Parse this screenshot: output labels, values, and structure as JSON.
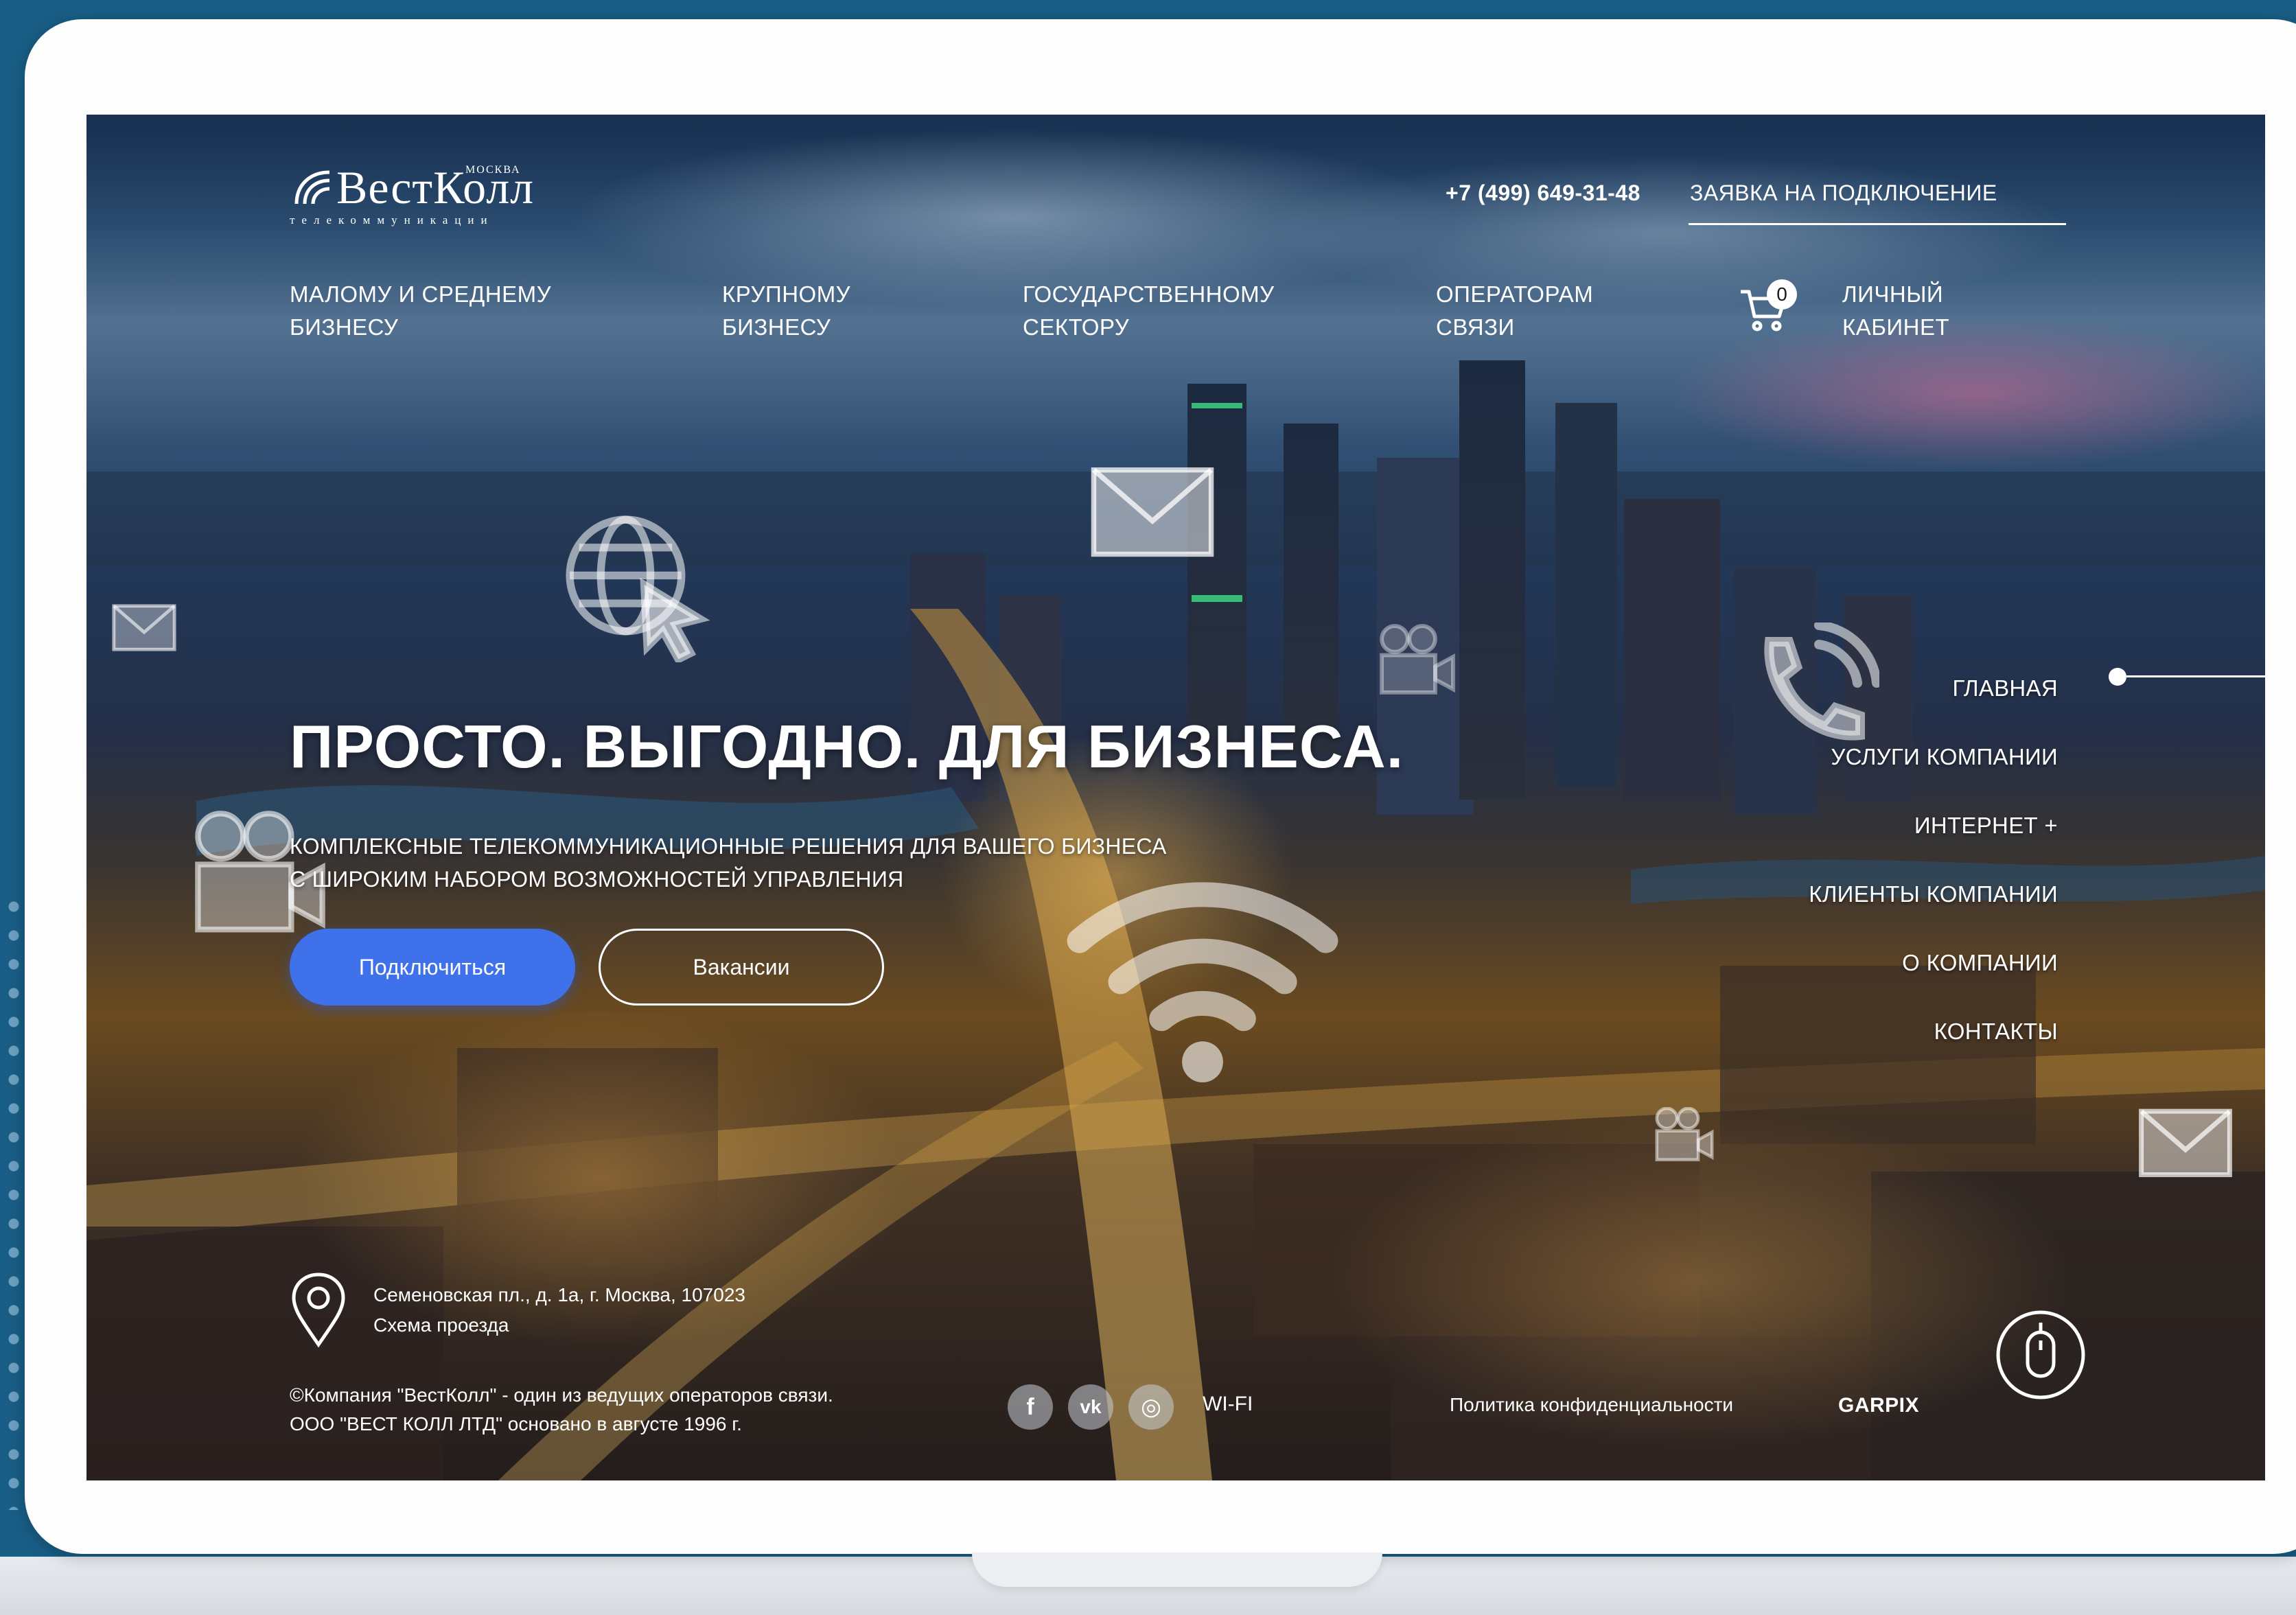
{
  "logo": {
    "name": "ВестКолл",
    "city": "МОСКВА",
    "tagline": "телекоммуникации"
  },
  "header": {
    "phone": "+7 (499) 649-31-48",
    "request_link": "ЗАЯВКА НА ПОДКЛЮЧЕНИЕ"
  },
  "nav": {
    "items": [
      {
        "line1": "МАЛОМУ И СРЕДНЕМУ",
        "line2": "БИЗНЕСУ"
      },
      {
        "line1": "КРУПНОМУ",
        "line2": "БИЗНЕСУ"
      },
      {
        "line1": "ГОСУДАРСТВЕННОМУ",
        "line2": "СЕКТОРУ"
      },
      {
        "line1": "ОПЕРАТОРАМ",
        "line2": "СВЯЗИ"
      }
    ],
    "cart_count": "0",
    "account": {
      "line1": "ЛИЧНЫЙ",
      "line2": "КАБИНЕТ"
    }
  },
  "hero": {
    "title": "ПРОСТО. ВЫГОДНО. ДЛЯ БИЗНЕСА.",
    "subtitle_line1": "КОМПЛЕКСНЫЕ ТЕЛЕКОММУНИКАЦИОННЫЕ РЕШЕНИЯ ДЛЯ ВАШЕГО БИЗНЕСА",
    "subtitle_line2": "С ШИРОКИМ НАБОРОМ ВОЗМОЖНОСТЕЙ УПРАВЛЕНИЯ",
    "primary_button": "Подключиться",
    "secondary_button": "Вакансии"
  },
  "side_nav": {
    "items": [
      "ГЛАВНАЯ",
      "УСЛУГИ КОМПАНИИ",
      "ИНТЕРНЕТ +",
      "КЛИЕНТЫ КОМПАНИИ",
      "О КОМПАНИИ",
      "КОНТАКТЫ"
    ]
  },
  "footer": {
    "address": "Семеновская пл., д. 1а, г. Москва, 107023",
    "directions_link": "Схема проезда",
    "copyright_line1": "©Компания \"ВестКолл\" - один из ведущих операторов связи.",
    "copyright_line2": "ООО \"ВЕСТ КОЛЛ ЛТД\" основано в августе 1996 г.",
    "social": [
      {
        "icon": "facebook-icon",
        "glyph": "f"
      },
      {
        "icon": "vk-icon",
        "glyph": "vk"
      },
      {
        "icon": "instagram-icon",
        "glyph": "◎"
      }
    ],
    "wifi_link": "WI-FI",
    "privacy_link": "Политика конфиденциальности",
    "developer": "GARPIX"
  },
  "colors": {
    "page_background": "#195e86",
    "primary_button": "#3f72ea",
    "text": "#ffffff"
  }
}
